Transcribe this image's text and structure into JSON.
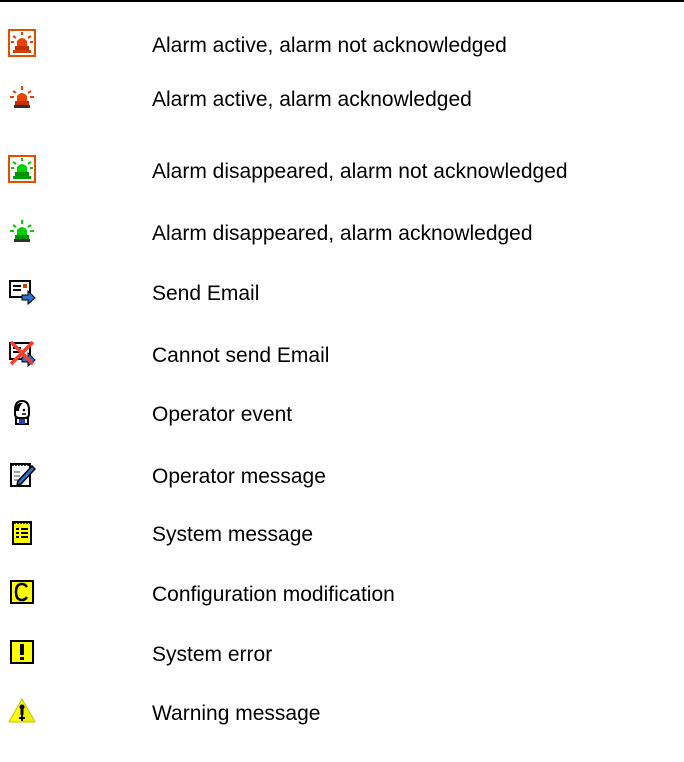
{
  "legend": {
    "items": [
      {
        "icon": "red-alarm-unacknowledged-icon",
        "label": "Alarm active, alarm not acknowledged"
      },
      {
        "icon": "red-alarm-acknowledged-icon",
        "label": "Alarm active, alarm acknowledged"
      },
      {
        "icon": "green-alarm-unacknowledged-icon",
        "label": "Alarm disappeared, alarm not acknowledged"
      },
      {
        "icon": "green-alarm-acknowledged-icon",
        "label": "Alarm disappeared, alarm acknowledged"
      },
      {
        "icon": "send-email-icon",
        "label": "Send Email"
      },
      {
        "icon": "email-failed-icon",
        "label": "Cannot send Email"
      },
      {
        "icon": "operator-icon",
        "label": "Operator event"
      },
      {
        "icon": "notepad-pencil-icon",
        "label": "Operator message"
      },
      {
        "icon": "system-notepad-icon",
        "label": "System message"
      },
      {
        "icon": "configuration-c-icon",
        "label": "Configuration modification"
      },
      {
        "icon": "exclamation-icon",
        "label": "System error"
      },
      {
        "icon": "warning-triangle-icon",
        "label": "Warning message"
      }
    ]
  },
  "colors": {
    "alarm_red": "#f04000",
    "alarm_green": "#00e000",
    "frame_orange": "#e05000",
    "icon_yellow": "#ffff00",
    "email_blue": "#3070d0"
  }
}
